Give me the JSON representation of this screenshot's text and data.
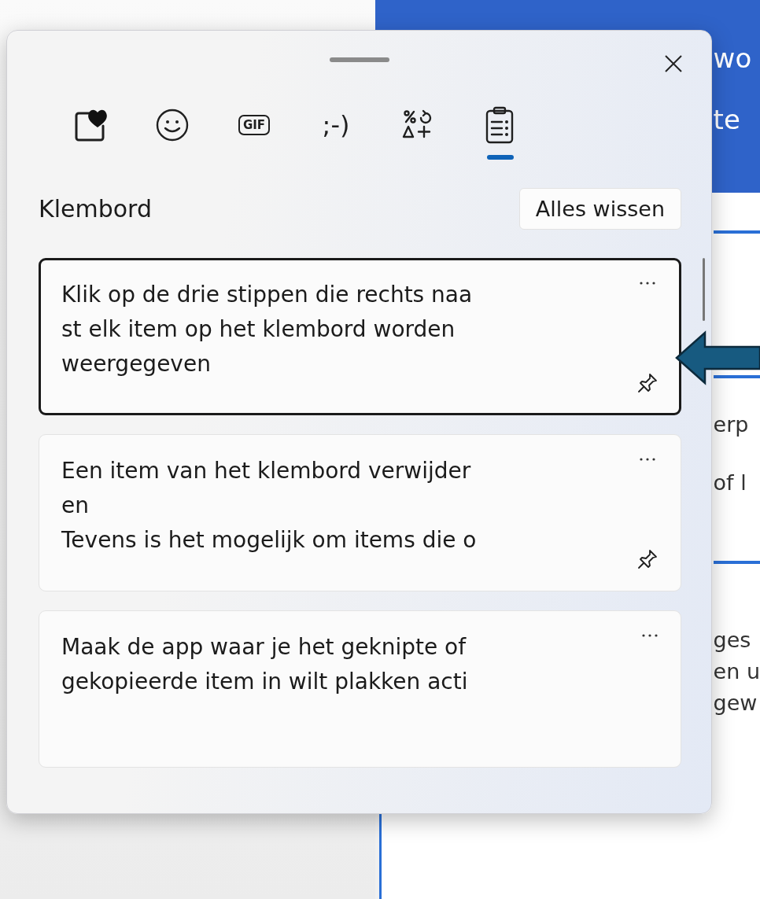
{
  "background": {
    "header_texts": [
      "wo",
      "te"
    ],
    "body_texts_upper": [
      "erp",
      "of l"
    ],
    "body_texts_lower": [
      "ges",
      "en u",
      "gew"
    ]
  },
  "panel": {
    "tabs": [
      {
        "kind": "favorites",
        "selected": false
      },
      {
        "kind": "emoji",
        "selected": false
      },
      {
        "kind": "gif",
        "label": "GIF",
        "selected": false
      },
      {
        "kind": "kaomoji",
        "label": ";-)",
        "selected": false
      },
      {
        "kind": "symbols",
        "selected": false
      },
      {
        "kind": "clipboard",
        "selected": true
      }
    ],
    "heading": "Klembord",
    "clear_button": "Alles wissen",
    "items": [
      {
        "lines": [
          "Klik op de drie stippen die rechts naa",
          "st elk item op het klembord worden",
          "weergegeven"
        ],
        "selected": true,
        "pin": true
      },
      {
        "lines": [
          "Een item van het klembord verwijder",
          "en",
          "Tevens is het mogelijk om items die o"
        ],
        "selected": false,
        "pin": true
      },
      {
        "lines": [
          "Maak de app waar je het geknipte of",
          "gekopieerde item in wilt plakken acti"
        ],
        "selected": false,
        "pin": false
      }
    ]
  }
}
